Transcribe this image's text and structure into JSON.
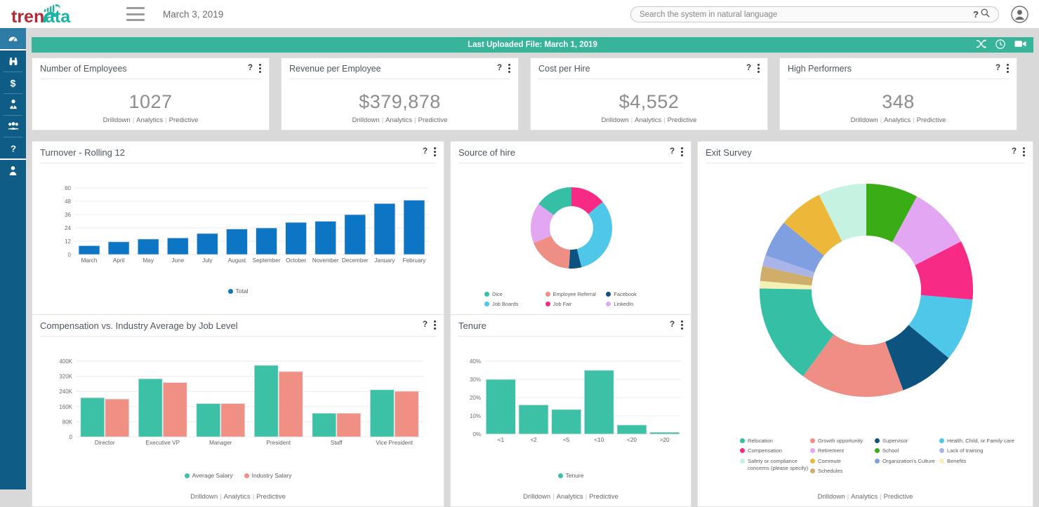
{
  "header": {
    "logo_text_1": "tren",
    "logo_text_2": "Data",
    "date": "March 3, 2019",
    "menu_icon": "hamburger-icon",
    "search_placeholder": "Search the system in natural language",
    "search_value": "",
    "help_glyph": "?",
    "avatar_icon": "user-avatar-icon"
  },
  "sidebar": {
    "items": [
      {
        "name": "dashboard",
        "icon": "gauge-icon",
        "active": true
      },
      {
        "name": "discover",
        "icon": "binoculars-icon",
        "active": false
      },
      {
        "name": "compensation",
        "icon": "dollar-icon",
        "active": false
      },
      {
        "name": "recruiting",
        "icon": "person-tie-icon",
        "active": false
      },
      {
        "name": "workforce",
        "icon": "people-group-icon",
        "active": false
      },
      {
        "name": "help",
        "icon": "question-mark-icon",
        "active": false
      },
      {
        "name": "profile",
        "icon": "person-icon",
        "active": false
      }
    ]
  },
  "banner": {
    "text": "Last Uploaded File: March 1, 2019",
    "color": "#37b49a",
    "icons": [
      "shuffle-icon",
      "clock-icon",
      "video-camera-icon"
    ]
  },
  "card_links": {
    "drilldown": "Drilldown",
    "analytics": "Analytics",
    "predictive": "Predictive"
  },
  "kpis": [
    {
      "title": "Number of Employees",
      "value": "1027"
    },
    {
      "title": "Revenue per Employee",
      "value": "$379,878"
    },
    {
      "title": "Cost per Hire",
      "value": "$4,552"
    },
    {
      "title": "High Performers",
      "value": "348"
    }
  ],
  "panels": {
    "turnover": {
      "title": "Turnover - Rolling 12"
    },
    "source_of_hire": {
      "title": "Source of hire"
    },
    "exit_survey": {
      "title": "Exit Survey"
    },
    "compensation": {
      "title": "Compensation vs. Industry Average by Job Level"
    },
    "tenure": {
      "title": "Tenure"
    }
  },
  "chart_data": [
    {
      "id": "turnover",
      "type": "bar",
      "title": "Turnover - Rolling 12",
      "categories": [
        "March",
        "April",
        "May",
        "June",
        "July",
        "August",
        "September",
        "October",
        "November",
        "December",
        "January",
        "February"
      ],
      "series": [
        {
          "name": "Total",
          "values": [
            8,
            11.5,
            14,
            15,
            19,
            23,
            24,
            29,
            30,
            36,
            46,
            49
          ],
          "color": "#0c76c4"
        }
      ],
      "ytick_labels": [
        "0",
        "12",
        "24",
        "36",
        "48",
        "60"
      ],
      "ylim": [
        0,
        60
      ],
      "xlabel": "",
      "ylabel": "",
      "grid": true,
      "legend": [
        {
          "label": "Total",
          "color": "#0c76c4"
        }
      ],
      "legend_position": "bottom"
    },
    {
      "id": "source_of_hire",
      "type": "pie",
      "title": "Source of hire",
      "donut": true,
      "labels": [
        "Job Fair",
        "Job Boards",
        "Facebook",
        "Employee Referral",
        "LinkedIn",
        "Dice"
      ],
      "values": [
        14,
        32,
        5,
        18,
        16,
        15
      ],
      "colors": [
        "#f72b86",
        "#4ec7e8",
        "#0d5380",
        "#ef8e84",
        "#e3a6f2",
        "#35bfa5"
      ],
      "legend": [
        {
          "label": "Dice",
          "color": "#35bfa5"
        },
        {
          "label": "Employee Referral",
          "color": "#ef8e84"
        },
        {
          "label": "Facebook",
          "color": "#0d5380"
        },
        {
          "label": "Job Boards",
          "color": "#4ec7e8"
        },
        {
          "label": "Job Fair",
          "color": "#f72b86"
        },
        {
          "label": "LinkedIn",
          "color": "#e3a6f2"
        }
      ],
      "legend_position": "bottom"
    },
    {
      "id": "exit_survey",
      "type": "pie",
      "title": "Exit Survey",
      "donut": true,
      "labels": [
        "School",
        "Retirement",
        "Compensation",
        "Health, Child, or Family care",
        "Supervisor",
        "Growth opportunity",
        "Relocation",
        "Benefits",
        "Schedules",
        "Lack of training",
        "Organization's Culture",
        "Commute",
        "Safety or compliance concerns (please specify)"
      ],
      "values": [
        7.0,
        8.5,
        8.0,
        8.5,
        7.5,
        14.0,
        13.5,
        1.0,
        2.0,
        1.5,
        5.0,
        6.0,
        6.5
      ],
      "colors": [
        "#3aad16",
        "#e3a6f2",
        "#f72b86",
        "#4ec7e8",
        "#0d5380",
        "#ef8e84",
        "#35bfa5",
        "#f3f1b5",
        "#cfae6b",
        "#a9b4e8",
        "#7f9fe0",
        "#edb83a",
        "#c6f2e2"
      ],
      "legend": [
        {
          "label": "Relocation",
          "color": "#35bfa5"
        },
        {
          "label": "Compensation",
          "color": "#f72b86"
        },
        {
          "label": "Safety or compliance concerns (please specify)",
          "color": "#c6f2e2"
        },
        {
          "label": "Growth opportunity",
          "color": "#ef8e84"
        },
        {
          "label": "Retirement",
          "color": "#e3a6f2"
        },
        {
          "label": "Commute",
          "color": "#edb83a"
        },
        {
          "label": "Schedules",
          "color": "#cfae6b"
        },
        {
          "label": "Supervisor",
          "color": "#0d5380"
        },
        {
          "label": "School",
          "color": "#3aad16"
        },
        {
          "label": "Organization's Culture",
          "color": "#7f9fe0"
        },
        {
          "label": "Health, Child, or Family care",
          "color": "#4ec7e8"
        },
        {
          "label": "Lack of training",
          "color": "#a9b4e8"
        },
        {
          "label": "Benefits",
          "color": "#f3f1b5"
        }
      ],
      "legend_position": "bottom"
    },
    {
      "id": "compensation",
      "type": "bar",
      "title": "Compensation vs. Industry Average by Job Level",
      "categories": [
        "Director",
        "Executive VP",
        "Manager",
        "President",
        "Staff",
        "Vice President"
      ],
      "series": [
        {
          "name": "Average Salary",
          "values": [
            207000,
            307000,
            176000,
            378000,
            125000,
            249000
          ],
          "color": "#3dc1a6"
        },
        {
          "name": "Industry Salary",
          "values": [
            200000,
            287000,
            176000,
            345000,
            125000,
            241000
          ],
          "color": "#f09084"
        }
      ],
      "ytick_labels": [
        "0",
        "80K",
        "160K",
        "240K",
        "320K",
        "400K"
      ],
      "ylim": [
        0,
        400000
      ],
      "xlabel": "",
      "ylabel": "",
      "grid": true,
      "legend": [
        {
          "label": "Average Salary",
          "color": "#3dc1a6"
        },
        {
          "label": "Industry Salary",
          "color": "#f09084"
        }
      ],
      "legend_position": "bottom"
    },
    {
      "id": "tenure",
      "type": "bar",
      "title": "Tenure",
      "categories": [
        "<1",
        "<2",
        "<5",
        "<10",
        "<20",
        ">20"
      ],
      "series": [
        {
          "name": "Tenure",
          "values": [
            30,
            16,
            13.5,
            35,
            5,
            1
          ],
          "color": "#3dc1a6"
        }
      ],
      "ytick_labels": [
        "0%",
        "10%",
        "20%",
        "30%",
        "40%"
      ],
      "ylim": [
        0,
        40
      ],
      "xlabel": "",
      "ylabel": "",
      "grid": true,
      "legend": [
        {
          "label": "Tenure",
          "color": "#3dc1a6"
        }
      ],
      "legend_position": "bottom"
    }
  ]
}
